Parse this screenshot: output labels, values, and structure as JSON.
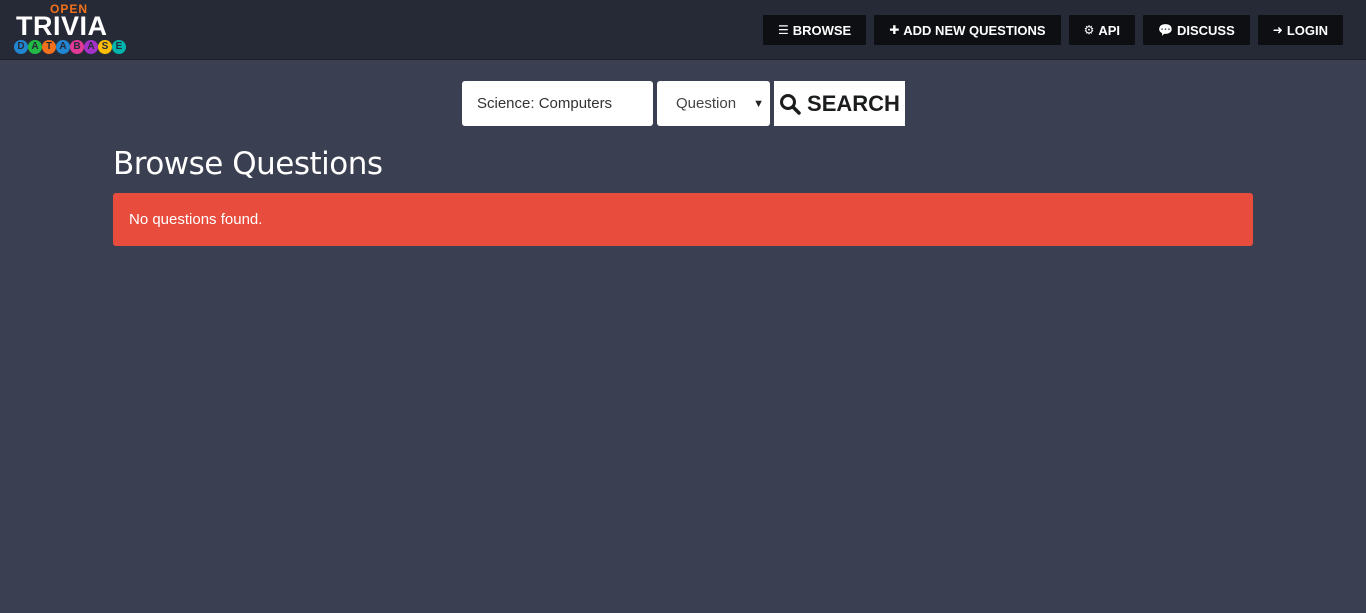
{
  "logo": {
    "open": "OPEN",
    "trivia": "TRIVIA",
    "database_letters": [
      "D",
      "A",
      "T",
      "A",
      "B",
      "A",
      "S",
      "E"
    ],
    "database_colors": [
      "#2185d0",
      "#21ba45",
      "#f2711c",
      "#2185d0",
      "#e03997",
      "#a333c8",
      "#fbbd08",
      "#00b5ad"
    ]
  },
  "nav": {
    "items": [
      {
        "label": "BROWSE",
        "icon": "bars-icon"
      },
      {
        "label": "ADD NEW QUESTIONS",
        "icon": "plus-icon"
      },
      {
        "label": "API",
        "icon": "gears-icon"
      },
      {
        "label": "DISCUSS",
        "icon": "comments-icon"
      },
      {
        "label": "LOGIN",
        "icon": "sign-in-icon"
      }
    ]
  },
  "search": {
    "input_value": "Science: Computers",
    "select_value": "Question",
    "button_label": "SEARCH"
  },
  "main": {
    "title": "Browse Questions",
    "alert": "No questions found."
  },
  "colors": {
    "background": "#3a3f51",
    "navbar": "#262a36",
    "alert": "#e74c3c"
  }
}
